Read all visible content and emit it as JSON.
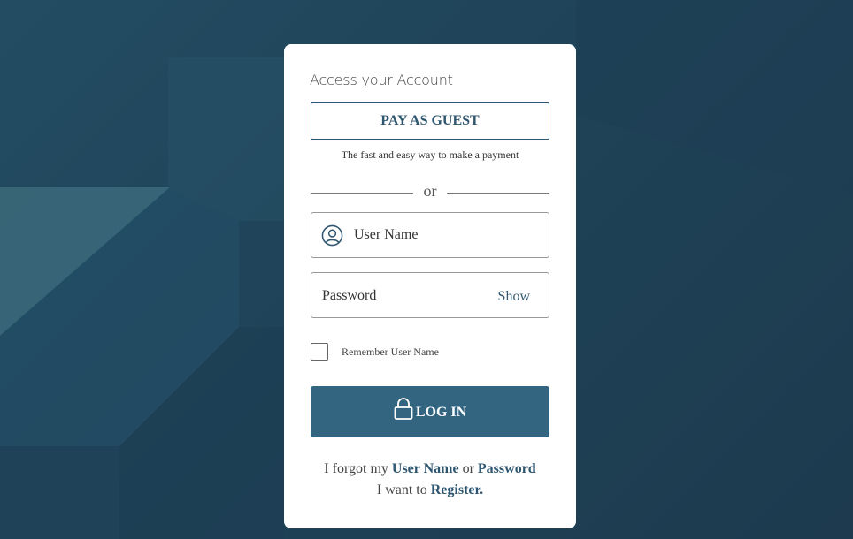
{
  "colors": {
    "accent": "#336581",
    "link": "#2e5670",
    "background": "#1f4358"
  },
  "card": {
    "heading": "Access your Account",
    "guest_button": "PAY AS GUEST",
    "guest_subtext": "The fast and easy way to make a payment",
    "divider_text": "or",
    "username_placeholder": "User Name",
    "password_placeholder": "Password",
    "show_label": "Show",
    "remember_label": "Remember User Name",
    "login_label": "LOG IN",
    "icons": {
      "user": "user-circle-icon",
      "lock": "lock-icon"
    }
  },
  "footer": {
    "forgot_prefix": "I forgot my",
    "username_link": "User Name",
    "or_text": "or",
    "password_link": "Password",
    "register_prefix": "I want to",
    "register_link": "Register."
  }
}
